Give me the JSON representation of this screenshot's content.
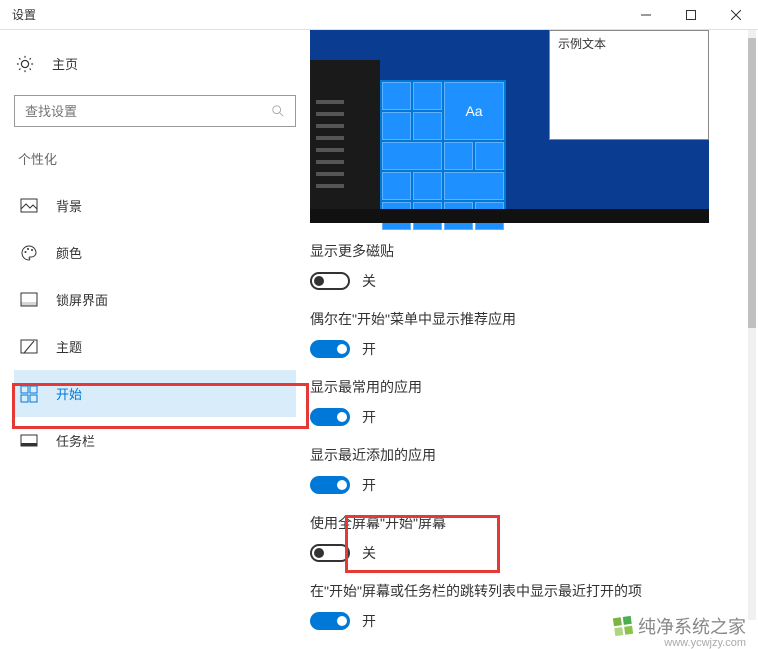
{
  "window": {
    "title": "设置"
  },
  "sidebar": {
    "home_label": "主页",
    "search_placeholder": "查找设置",
    "category": "个性化",
    "items": [
      {
        "label": "背景"
      },
      {
        "label": "颜色"
      },
      {
        "label": "锁屏界面"
      },
      {
        "label": "主题"
      },
      {
        "label": "开始"
      },
      {
        "label": "任务栏"
      }
    ]
  },
  "preview": {
    "tile_text": "Aa",
    "sample_text": "示例文本"
  },
  "settings": [
    {
      "label": "显示更多磁贴",
      "on": false,
      "state": "关"
    },
    {
      "label": "偶尔在\"开始\"菜单中显示推荐应用",
      "on": true,
      "state": "开"
    },
    {
      "label": "显示最常用的应用",
      "on": true,
      "state": "开"
    },
    {
      "label": "显示最近添加的应用",
      "on": true,
      "state": "开"
    },
    {
      "label": "使用全屏幕\"开始\"屏幕",
      "on": false,
      "state": "关"
    },
    {
      "label": "在\"开始\"屏幕或任务栏的跳转列表中显示最近打开的项",
      "on": true,
      "state": "开"
    }
  ],
  "watermark": {
    "text": "纯净系统之家",
    "url": "www.ycwjzy.com"
  }
}
